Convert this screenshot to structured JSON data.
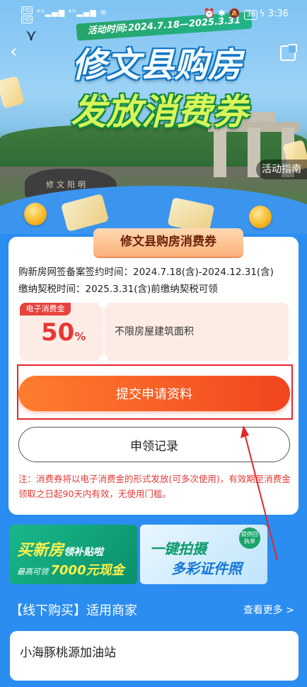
{
  "status_bar": {
    "network_badge": "HD",
    "signal": "4G 4G",
    "battery": "38",
    "time": "3:36"
  },
  "hero": {
    "date_ribbon": "活动时间:2024.7.18—2025.3.31",
    "title_line1": "修文县购房",
    "title_line2": "发放消费券",
    "guide_button": "活动指南"
  },
  "card": {
    "title": "修文县购房消费券",
    "line1": "购新房网签备案签约时间：2024.7.18(含)-2024.12.31(含)",
    "line2": "缴纳契税时间：2025.3.31(含)前缴纳契税可领",
    "coupon": {
      "tag": "电子消费金",
      "percent": "50",
      "percent_unit": "%",
      "description": "不限房屋建筑面积"
    },
    "submit_button": "提交申请资料",
    "record_button": "申领记录",
    "notice": "注：消费券将以电子消费金的形式发放(可多次使用)，有效期至消费金领取之日起90天内有效，无使用门槛。"
  },
  "banners": {
    "left_title": "买新房",
    "left_title_small": "领补贴啦",
    "left_sub_prefix": "最高可领",
    "left_sub_amount": "7000元现金",
    "right_line1": "一键拍摄",
    "right_line2": "多彩证件照",
    "right_stamp": "提供回执单"
  },
  "merchants_section": {
    "title": "【线下购买】适用商家",
    "more": "查看更多 >",
    "items": [
      "小海豚桃源加油站"
    ]
  },
  "colors": {
    "primary_orange": "#f1451f",
    "page_blue": "#2b8df0",
    "notice_red": "#e53935"
  }
}
